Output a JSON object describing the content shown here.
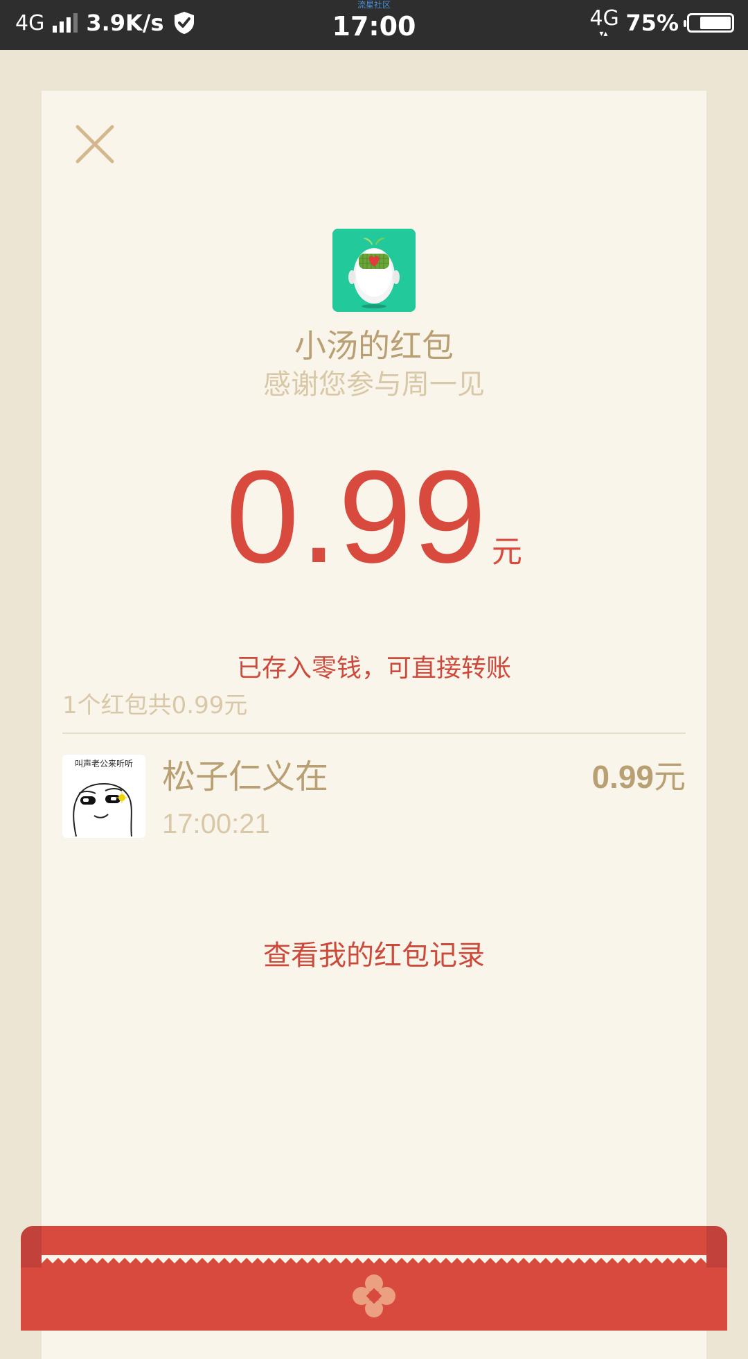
{
  "status_bar": {
    "network": "4G",
    "speed": "3.9K/s",
    "watermark": "流星社区",
    "time": "17:00",
    "data_network": "4G",
    "data_arrows": "▾▴",
    "battery_text": "75%",
    "battery_level": 0.75
  },
  "card": {
    "sender_title": "小汤的红包",
    "greeting": "感谢您参与周一见",
    "amount": "0.99",
    "amount_unit": "元",
    "amount_note": "已存入零钱，可直接转账",
    "summary": "1个红包共0.99元",
    "records": [
      {
        "avatar_caption": "叫声老公来听听",
        "name": "松子仁义在",
        "time": "17:00:21",
        "amount": "0.99",
        "amount_unit": "元"
      }
    ],
    "view_records_label": "查看我的红包记录"
  },
  "icons": {
    "close": "close-icon",
    "shield": "shield-check-icon",
    "emblem": "flower-emblem-icon"
  },
  "colors": {
    "accent_red": "#d84a3e",
    "gold": "#b8a074",
    "muted_gold": "#d8c8a8",
    "card_bg": "#faf5ea",
    "page_bg": "#ede5d3",
    "avatar_green": "#21c99b"
  }
}
